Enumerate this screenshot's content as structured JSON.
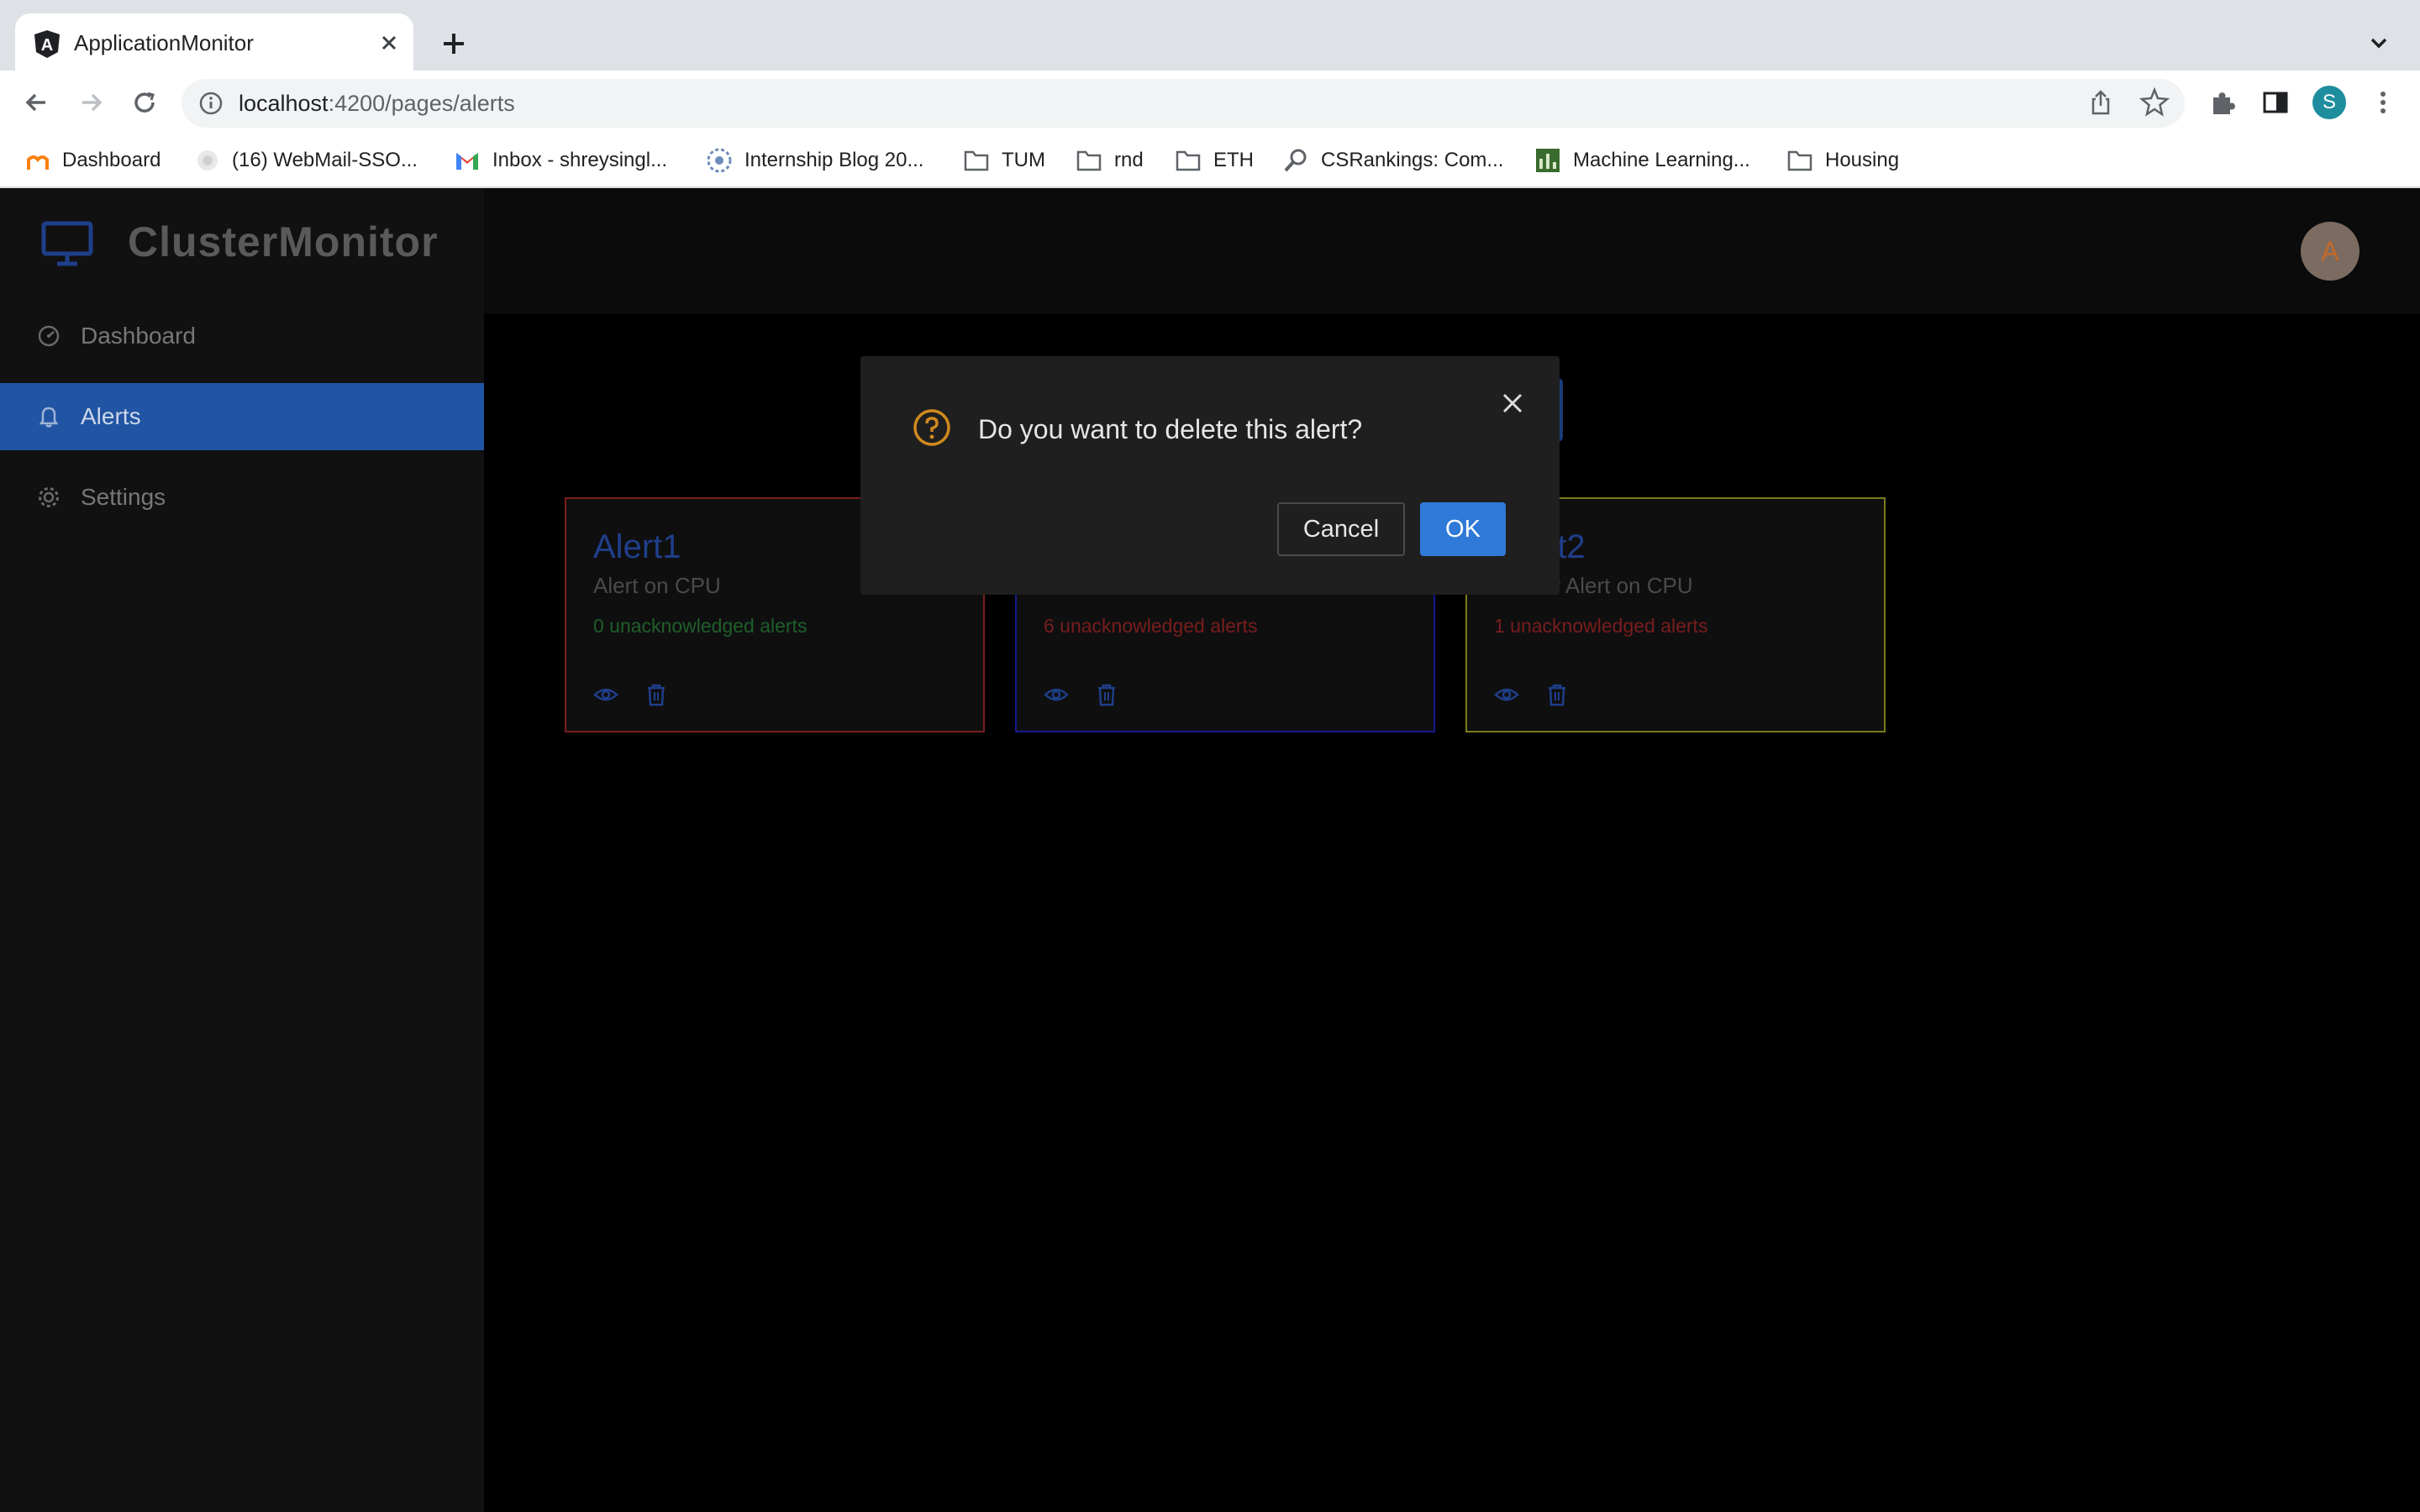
{
  "browser": {
    "tab_title": "ApplicationMonitor",
    "url_host": "localhost",
    "url_path": ":4200/pages/alerts",
    "bookmarks": [
      {
        "label": "Dashboard",
        "icon": "moodle-icon"
      },
      {
        "label": "(16) WebMail-SSO...",
        "icon": "webmail-icon"
      },
      {
        "label": "Inbox - shreysingl...",
        "icon": "gmail-icon"
      },
      {
        "label": "Internship Blog 20...",
        "icon": "blog-icon"
      },
      {
        "label": "TUM",
        "icon": "folder-icon"
      },
      {
        "label": "rnd",
        "icon": "folder-icon"
      },
      {
        "label": "ETH",
        "icon": "folder-icon"
      },
      {
        "label": "CSRankings: Com...",
        "icon": "magnifier-icon"
      },
      {
        "label": "Machine Learning...",
        "icon": "ml-icon"
      },
      {
        "label": "Housing",
        "icon": "folder-icon"
      }
    ],
    "profile_initial": "S"
  },
  "app": {
    "brand": "ClusterMonitor",
    "nav": [
      {
        "label": "Dashboard",
        "icon": "dashboard-icon"
      },
      {
        "label": "Alerts",
        "icon": "bell-icon"
      },
      {
        "label": "Settings",
        "icon": "gear-icon"
      }
    ],
    "active_nav": "Alerts",
    "user_initial": "A"
  },
  "cards": [
    {
      "title": "Alert1",
      "subtitle": "Alert on CPU",
      "count_text": "0 unacknowledged alerts",
      "count_color": "#1f5f2a",
      "border": "#7a1d1d"
    },
    {
      "title": "",
      "subtitle": "",
      "count_text": "6 unacknowledged alerts",
      "count_color": "#7a1d1d",
      "border": "#141a8a"
    },
    {
      "title": "rt2",
      "subtitle": "er Alert on CPU",
      "count_text": "1 unacknowledged alerts",
      "count_color": "#7a1d1d",
      "border": "#7a7a1a"
    }
  ],
  "dialog": {
    "message": "Do you want to delete this alert?",
    "cancel_label": "Cancel",
    "ok_label": "OK"
  },
  "colors": {
    "accent": "#2154a3",
    "ok_button": "#2f7ad8",
    "question_icon": "#d08a1e"
  }
}
